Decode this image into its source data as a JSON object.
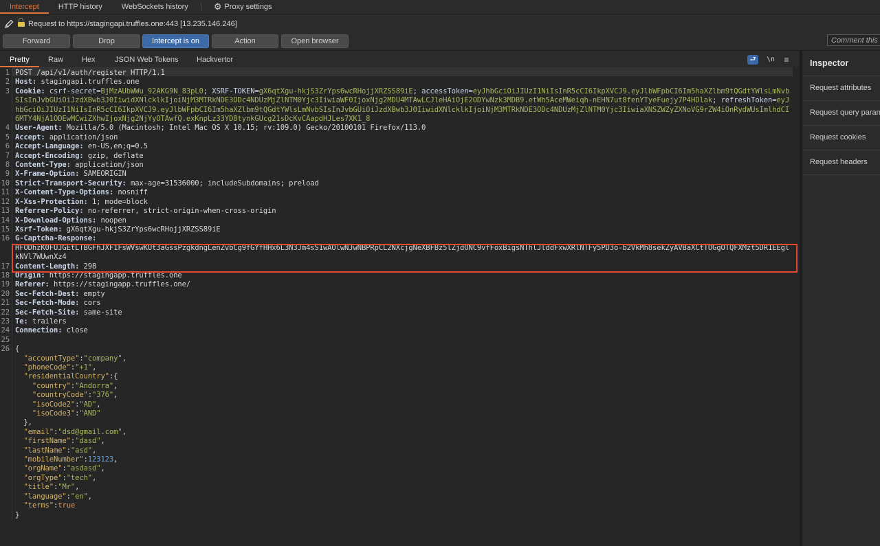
{
  "top_tabs": [
    {
      "label": "Intercept",
      "active": true
    },
    {
      "label": "HTTP history",
      "active": false
    },
    {
      "label": "WebSockets history",
      "active": false
    },
    {
      "label": "Proxy settings",
      "active": false,
      "icon": "gear-icon"
    }
  ],
  "request_bar": {
    "text": "Request to https://stagingapi.truffles.one:443  [13.235.146.246]",
    "icons": [
      "pencil-icon",
      "lock-icon"
    ]
  },
  "buttons": {
    "forward": "Forward",
    "drop": "Drop",
    "intercept": "Intercept is on",
    "action": "Action",
    "open_browser": "Open browser"
  },
  "comment_placeholder": "Comment this item",
  "editor_tabs": [
    {
      "label": "Pretty",
      "active": true
    },
    {
      "label": "Raw",
      "active": false
    },
    {
      "label": "Hex",
      "active": false
    },
    {
      "label": "JSON Web Tokens",
      "active": false
    },
    {
      "label": "Hackvertor",
      "active": false
    }
  ],
  "editor_tools": {
    "wrap": "⮐",
    "newline": "\\n",
    "menu": "≡"
  },
  "request": {
    "line1": "POST /api/v1/auth/register HTTP/1.1",
    "host": {
      "n": "Host:",
      "v": " stagingapi.truffles.one"
    },
    "cookie": {
      "n": "Cookie:",
      "k1": " csrf-secret=",
      "v1": "BjMzAUbWWu_92AKG9N_83pL0",
      "k2": "; XSRF-TOKEN=",
      "v2": "gX6qtXgu-hkjS3ZrYps6wcRHojjXRZSS89iE",
      "k3": "; accessToken=",
      "v3": "eyJhbGciOiJIUzI1NiIsInR5cCI6IkpXVCJ9.eyJlbWFpbCI6Im5haXZlbm9tQGdtYWlsLmNvbSIsInJvbGUiOiJzdXBwb3J0IiwidXNlcklkIjoiNjM3MTRkNDE3ODc4NDUzMjZlNTM0Yjc3IiwiaWF0IjoxNjg2MDU4MTAwLCJleHAiOjE2ODYwNzk3MDB9.etWh5AceMWeiqh-nEHN7ut8fenYTyeFuejy7P4HDlak",
      "k4": "; refreshToken=",
      "v4": "eyJhbGciOiJIUzI1NiIsInR5cCI6IkpXVCJ9.eyJlbWFpbCI6Im5haXZlbm9tQGdtYWlsLmNvbSIsInJvbGUiOiJzdXBwb3J0IiwidXNlcklkIjoiNjM3MTRkNDE3ODc4NDUzMjZlNTM0Yjc3IiwiaXNSZWZyZXNoVG9rZW4iOnRydWUsImlhdCI6MTY4NjA1ODEwMCwiZXhwIjoxNjg2NjYyOTAwfQ.exKnpLz33YD8tynkGUcg21sDcKvCAapdHJLes7XK1_8"
    },
    "headers": [
      {
        "n": "User-Agent:",
        "v": " Mozilla/5.0 (Macintosh; Intel Mac OS X 10.15; rv:109.0) Gecko/20100101 Firefox/113.0"
      },
      {
        "n": "Accept:",
        "v": " application/json"
      },
      {
        "n": "Accept-Language:",
        "v": " en-US,en;q=0.5"
      },
      {
        "n": "Accept-Encoding:",
        "v": " gzip, deflate"
      },
      {
        "n": "Content-Type:",
        "v": " application/json"
      },
      {
        "n": "X-Frame-Option:",
        "v": " SAMEORIGIN"
      },
      {
        "n": "Strict-Transport-Security:",
        "v": " max-age=31536000; includeSubdomains; preload"
      },
      {
        "n": "X-Content-Type-Options:",
        "v": " nosniff"
      },
      {
        "n": "X-Xss-Protection:",
        "v": " 1; mode=block"
      },
      {
        "n": "Referrer-Policy:",
        "v": " no-referrer, strict-origin-when-cross-origin"
      },
      {
        "n": "X-Download-Options:",
        "v": " noopen"
      },
      {
        "n": "Xsrf-Token:",
        "v": " gX6qtXgu-hkjS3ZrYps6wcRHojjXRZSS89iE"
      }
    ],
    "captcha": {
      "n": "G-Captcha-Response:",
      "v": "HFODhzK0FUJGEtLTBGFhJXF1FsWVswKUt3aGssPzgkdngLenZvbCg9fGYfHHx6L3N3Jm4sS1wAOlwNJwNBPRpCL2NXcjgNeXBFBz5lZjdONC9vfFoxBigsNThlJlddFxwXRlNTFy5PD3o-b2VkMh8sekZyAVBaXCtTOGgOTQFXMzt5DR1EEglkNVl7WUwnXz4"
    },
    "headers2": [
      {
        "n": "Content-Length:",
        "v": " 298"
      },
      {
        "n": "Origin:",
        "v": " https://stagingapp.truffles.one"
      },
      {
        "n": "Referer:",
        "v": " https://stagingapp.truffles.one/"
      },
      {
        "n": "Sec-Fetch-Dest:",
        "v": " empty"
      },
      {
        "n": "Sec-Fetch-Mode:",
        "v": " cors"
      },
      {
        "n": "Sec-Fetch-Site:",
        "v": " same-site"
      },
      {
        "n": "Te:",
        "v": " trailers"
      },
      {
        "n": "Connection:",
        "v": " close"
      }
    ],
    "body": {
      "open": "{",
      "accountType": "\"company\"",
      "phoneCode": "\"+1\"",
      "residentialCountry_open": "{",
      "country": "\"Andorra\"",
      "countryCode": "\"376\"",
      "isoCode2": "\"AD\"",
      "isoCode3": "\"AND\"",
      "residentialCountry_close": "},",
      "email": "\"dsd@gmail.com\"",
      "firstName": "\"dasd\"",
      "lastName": "\"asd\"",
      "mobileNumber": "123123",
      "orgName": "\"asdasd\"",
      "orgType": "\"tech\"",
      "title": "\"Mr\"",
      "language": "\"en\"",
      "terms": "true",
      "close": "}"
    },
    "body_keys": {
      "accountType": "\"accountType\"",
      "phoneCode": "\"phoneCode\"",
      "residentialCountry": "\"residentialCountry\"",
      "country": "\"country\"",
      "countryCode": "\"countryCode\"",
      "isoCode2": "\"isoCode2\"",
      "isoCode3": "\"isoCode3\"",
      "email": "\"email\"",
      "firstName": "\"firstName\"",
      "lastName": "\"lastName\"",
      "mobileNumber": "\"mobileNumber\"",
      "orgName": "\"orgName\"",
      "orgType": "\"orgType\"",
      "title": "\"title\"",
      "language": "\"language\"",
      "terms": "\"terms\""
    },
    "line_numbers": [
      "1",
      "2",
      "3",
      "4",
      "5",
      "6",
      "7",
      "8",
      "9",
      "10",
      "11",
      "12",
      "13",
      "14",
      "15",
      "16",
      "17",
      "18",
      "19",
      "20",
      "21",
      "22",
      "23",
      "24",
      "25",
      "26"
    ]
  },
  "inspector": {
    "title": "Inspector",
    "items": [
      "Request attributes",
      "Request query parameters",
      "Request cookies",
      "Request headers"
    ]
  },
  "colors": {
    "accent": "#e0743d",
    "intercept_on": "#3c6aa8",
    "highlight_box": "#e14a2f"
  }
}
